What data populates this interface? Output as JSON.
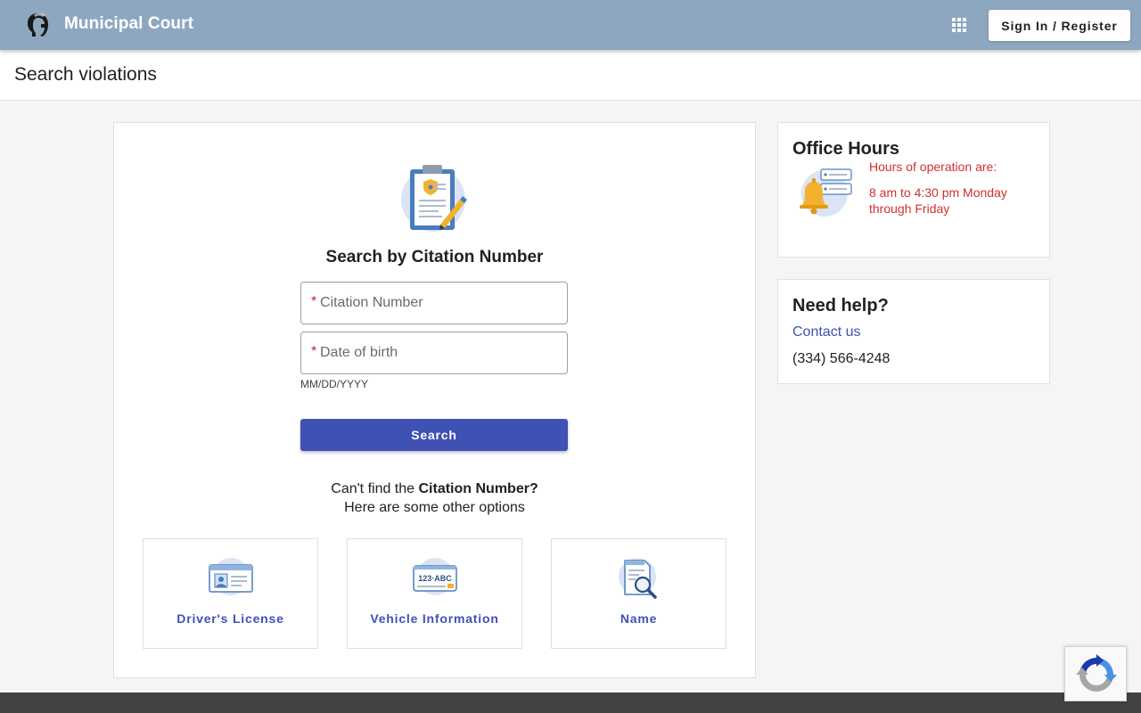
{
  "header": {
    "logo_icon": "spartan-helmet-icon",
    "app_title": "Municipal Court",
    "apps_icon": "apps-grid-icon",
    "signin_label": "Sign In / Register",
    "background_color": "#8ea7c1"
  },
  "page": {
    "title": "Search violations"
  },
  "search": {
    "illustration": "clipboard-badge-icon",
    "heading": "Search by Citation Number",
    "citation_placeholder": "Citation Number",
    "dob_placeholder": "Date of birth",
    "required_marker": "*",
    "dob_hint": "MM/DD/YYYY",
    "search_label": "Search",
    "accent_color": "#3f51b5"
  },
  "alternatives": {
    "line1_prefix": "Can't find the ",
    "line1_bold": "Citation Number?",
    "line2": "Here are some other options",
    "options": [
      {
        "label": "Driver's License",
        "icon": "id-card-icon"
      },
      {
        "label": "Vehicle Information",
        "icon": "license-plate-icon"
      },
      {
        "label": "Name",
        "icon": "document-search-icon"
      }
    ]
  },
  "office_hours": {
    "title": "Office Hours",
    "icon": "bell-notification-icon",
    "line1": "Hours of operation are:",
    "line2": "8 am to 4:30 pm Monday through Friday",
    "text_color": "#d32f2f"
  },
  "help": {
    "title": "Need help?",
    "contact_label": "Contact us",
    "phone": "(334) 566-4248"
  },
  "recaptcha": {
    "icon": "recaptcha-icon"
  }
}
